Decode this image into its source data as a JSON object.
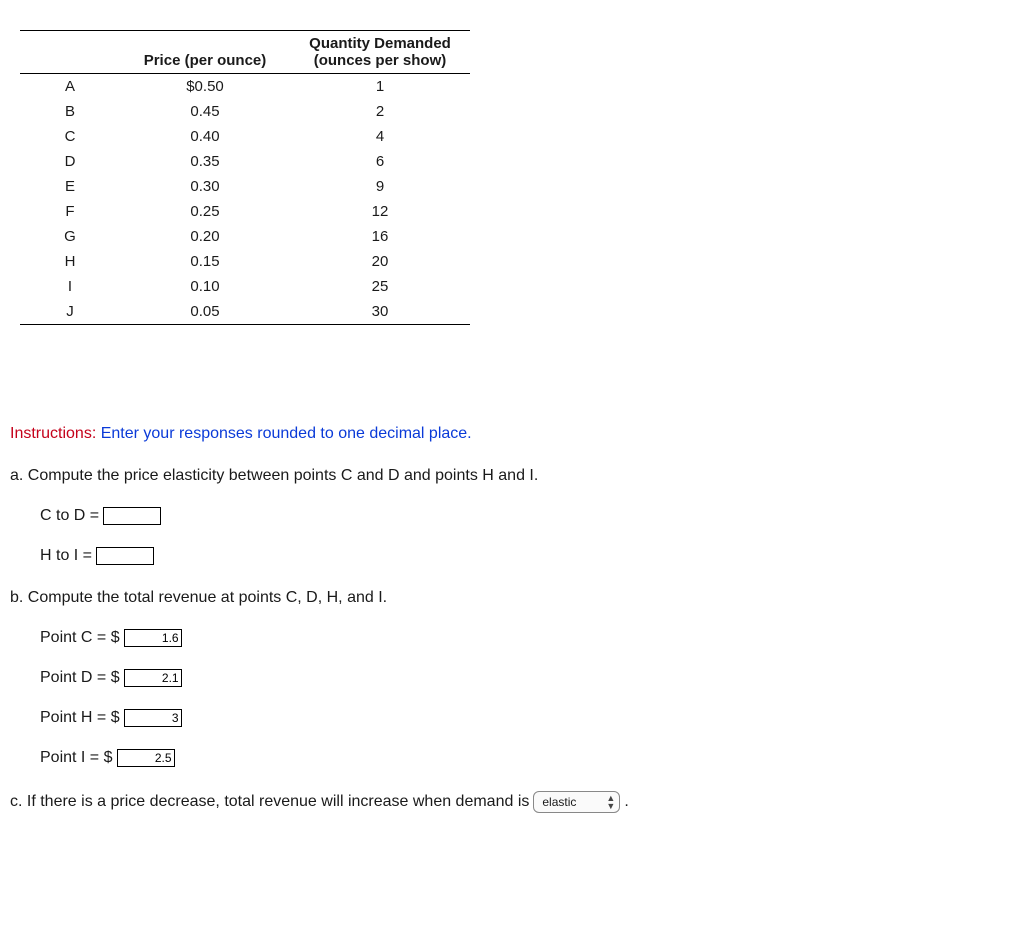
{
  "table": {
    "headers": [
      "",
      "Price (per ounce)",
      "Quantity Demanded (ounces per show)"
    ],
    "rows": [
      {
        "label": "A",
        "price": "$0.50",
        "qty": "1"
      },
      {
        "label": "B",
        "price": "0.45",
        "qty": "2"
      },
      {
        "label": "C",
        "price": "0.40",
        "qty": "4"
      },
      {
        "label": "D",
        "price": "0.35",
        "qty": "6"
      },
      {
        "label": "E",
        "price": "0.30",
        "qty": "9"
      },
      {
        "label": "F",
        "price": "0.25",
        "qty": "12"
      },
      {
        "label": "G",
        "price": "0.20",
        "qty": "16"
      },
      {
        "label": "H",
        "price": "0.15",
        "qty": "20"
      },
      {
        "label": "I",
        "price": "0.10",
        "qty": "25"
      },
      {
        "label": "J",
        "price": "0.05",
        "qty": "30"
      }
    ]
  },
  "instructions": {
    "label": "Instructions:",
    "text": "Enter your responses rounded to one decimal place."
  },
  "qa": {
    "text": "a. Compute the price elasticity between points C and D and points H and I.",
    "fields": [
      {
        "label": "C to D =",
        "value": ""
      },
      {
        "label": "H to I =",
        "value": ""
      }
    ]
  },
  "qb": {
    "text": "b. Compute the total revenue at points C, D, H, and I.",
    "fields": [
      {
        "label": "Point C = $",
        "value": "1.6"
      },
      {
        "label": "Point D = $",
        "value": "2.1"
      },
      {
        "label": "Point H = $",
        "value": "3"
      },
      {
        "label": "Point I = $",
        "value": "2.5"
      }
    ]
  },
  "qc": {
    "text_before": "c. If there is a price decrease, total revenue will increase when demand is",
    "select_value": "elastic",
    "text_after": "."
  }
}
